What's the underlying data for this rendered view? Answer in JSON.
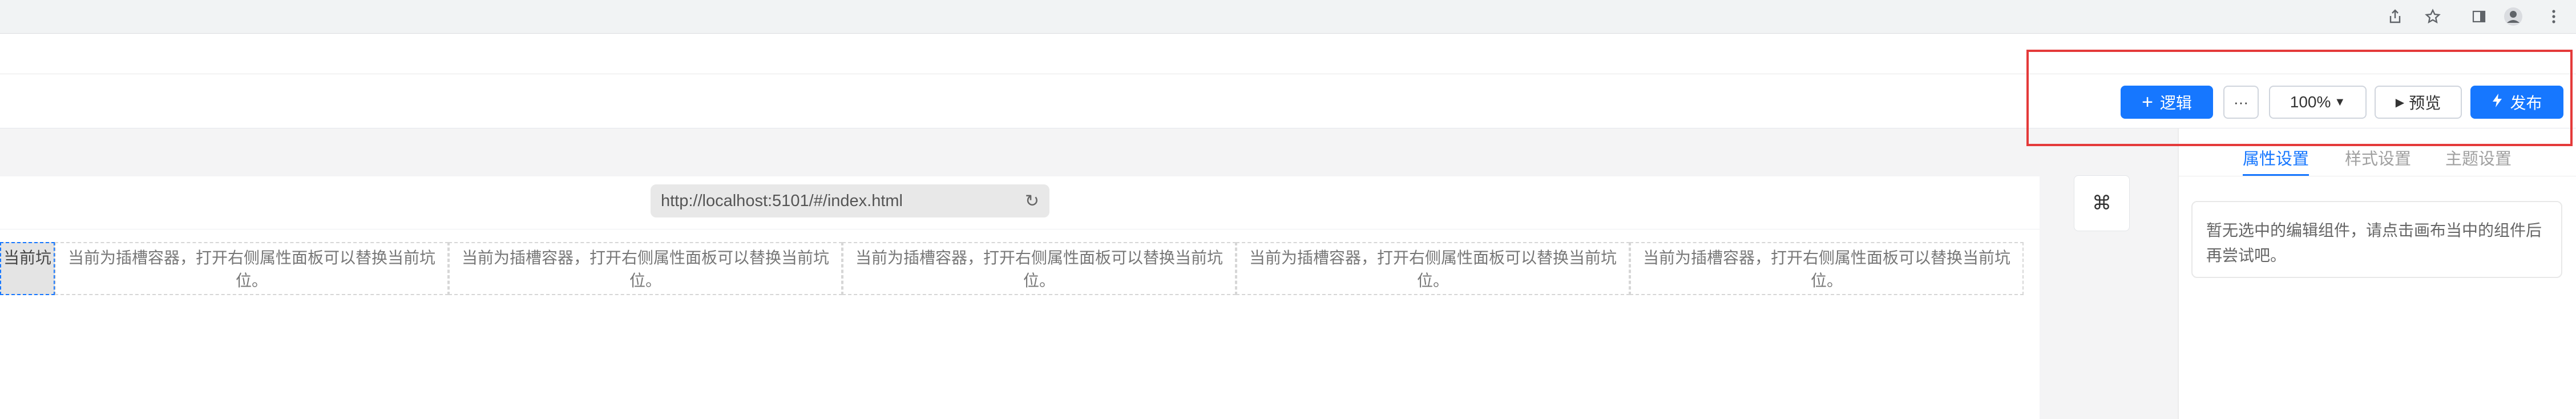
{
  "browser": {
    "icons": [
      "share-icon",
      "star-icon",
      "side-panel-icon",
      "profile-icon",
      "kebab-menu-icon"
    ]
  },
  "toolbar": {
    "logic_label": "逻辑",
    "more_label": "···",
    "zoom_label": "100%",
    "preview_label": "预览",
    "publish_label": "发布"
  },
  "canvas": {
    "url": "http://localhost:5101/#/index.html",
    "slots": [
      {
        "text": "当前坑"
      },
      {
        "text": "当前为插槽容器，打开右侧属性面板可以替换当前坑位。"
      },
      {
        "text": "当前为插槽容器，打开右侧属性面板可以替换当前坑位。"
      },
      {
        "text": "当前为插槽容器，打开右侧属性面板可以替换当前坑位。"
      },
      {
        "text": "当前为插槽容器，打开右侧属性面板可以替换当前坑位。"
      },
      {
        "text": "当前为插槽容器，打开右侧属性面板可以替换当前坑位。"
      }
    ]
  },
  "panel": {
    "tabs": [
      "属性设置",
      "样式设置",
      "主题设置"
    ],
    "active_tab": "属性设置",
    "empty_message": "暂无选中的编辑组件，请点击画布当中的组件后再尝试吧。"
  },
  "colors": {
    "primary": "#1677ff",
    "highlight": "#e43a3a"
  }
}
